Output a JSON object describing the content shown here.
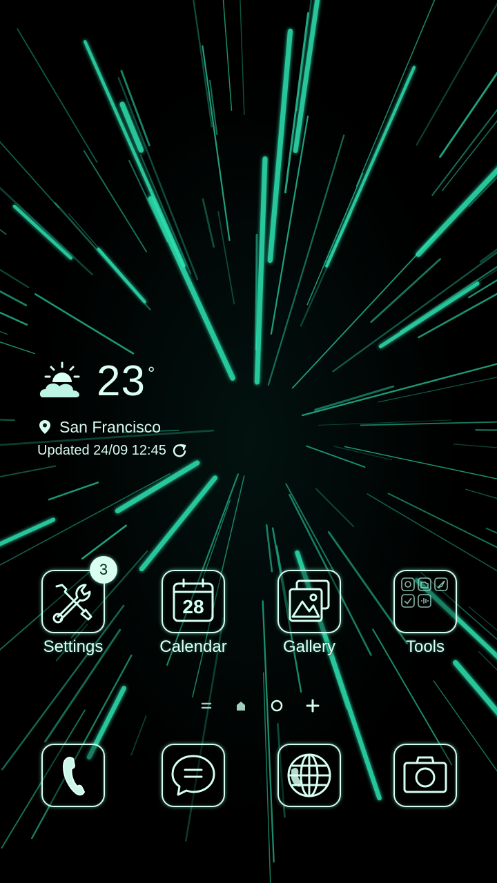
{
  "weather": {
    "temperature": "23",
    "degree_symbol": "°",
    "location": "San Francisco",
    "updated": "Updated 24/09 12:45",
    "icon": "partly-sunny-icon"
  },
  "apps": [
    {
      "label": "Settings",
      "icon": "settings-tools-icon",
      "badge": "3"
    },
    {
      "label": "Calendar",
      "icon": "calendar-icon",
      "day": "28"
    },
    {
      "label": "Gallery",
      "icon": "gallery-icon"
    },
    {
      "label": "Tools",
      "icon": "tools-folder-icon"
    }
  ],
  "page_indicator": [
    "menu-lines-icon",
    "home-icon",
    "circle-page-icon",
    "add-page-icon"
  ],
  "dock": [
    {
      "icon": "phone-icon"
    },
    {
      "icon": "messages-icon"
    },
    {
      "icon": "browser-globe-icon"
    },
    {
      "icon": "camera-icon"
    }
  ],
  "colors": {
    "accent": "#2ee8b6",
    "glyph": "#d5fff0",
    "background": "#000000"
  }
}
